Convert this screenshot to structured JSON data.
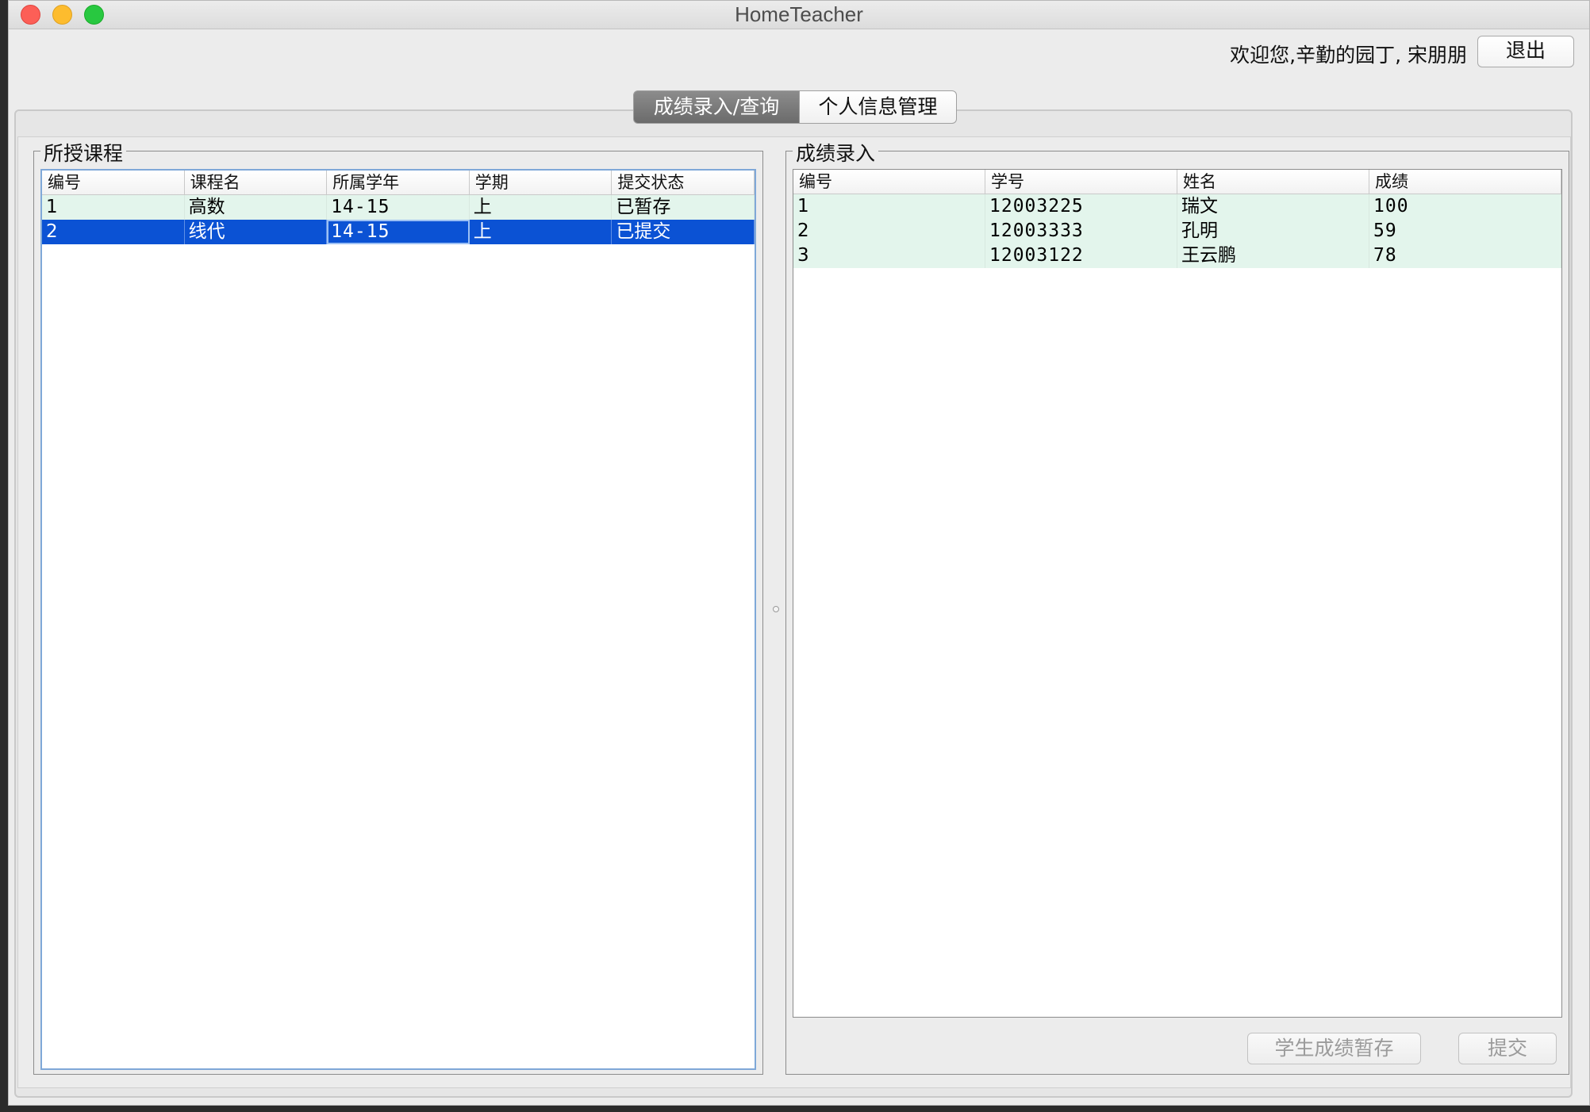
{
  "window": {
    "title": "HomeTeacher"
  },
  "header": {
    "welcome_text": "欢迎您,辛勤的园丁,  宋朋朋",
    "logout_label": "退出"
  },
  "tabs": [
    {
      "label": "成绩录入/查询",
      "active": true
    },
    {
      "label": "个人信息管理",
      "active": false
    }
  ],
  "courses_panel": {
    "title": "所授课程",
    "columns": [
      "编号",
      "课程名",
      "所属学年",
      "学期",
      "提交状态"
    ],
    "rows": [
      {
        "id": "1",
        "name": "高数",
        "year": "14-15",
        "term": "上",
        "status": "已暂存",
        "selected": false
      },
      {
        "id": "2",
        "name": "线代",
        "year": "14-15",
        "term": "上",
        "status": "已提交",
        "selected": true
      }
    ]
  },
  "grades_panel": {
    "title": "成绩录入",
    "columns": [
      "编号",
      "学号",
      "姓名",
      "成绩"
    ],
    "rows": [
      {
        "id": "1",
        "student_no": "12003225",
        "name": "瑞文",
        "score": "100"
      },
      {
        "id": "2",
        "student_no": "12003333",
        "name": "孔明",
        "score": "59"
      },
      {
        "id": "3",
        "student_no": "12003122",
        "name": "王云鹏",
        "score": "78"
      }
    ],
    "save_label": "学生成绩暂存",
    "submit_label": "提交"
  },
  "colors": {
    "selection": "#0b52d4",
    "row_tint": "#e3f5ec",
    "active_tab": "#7a7a7a"
  }
}
